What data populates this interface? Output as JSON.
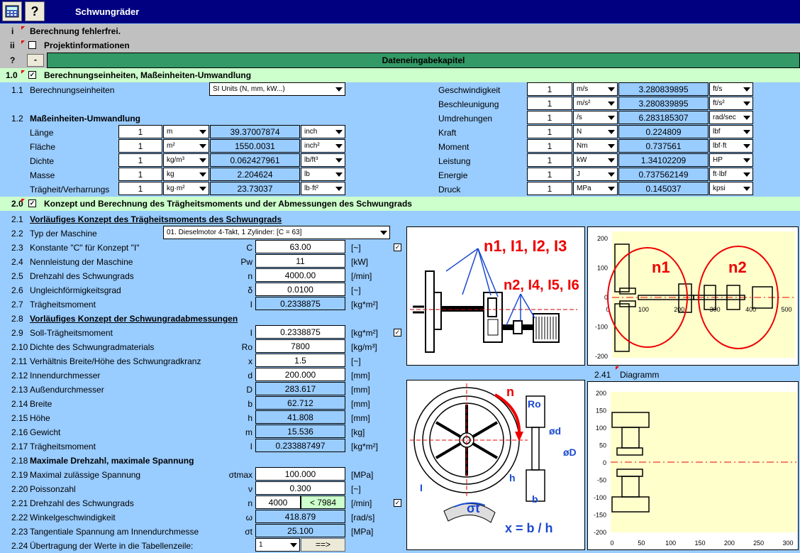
{
  "app": {
    "title": "Schwungräder",
    "help_label": "?"
  },
  "status": {
    "i_label": "i",
    "message": "Berechnung fehlerfrei.",
    "ii_label": "ii",
    "project_label": "Projektinformationen"
  },
  "chapter": {
    "q_label": "?",
    "minus_label": "-",
    "title": "Dateneingabekapitel"
  },
  "s10": {
    "num": "1.0",
    "title": "Berechnungseinheiten, Maßeinheiten-Umwandlung"
  },
  "r11": {
    "num": "1.1",
    "label": "Berechnungseinheiten",
    "select": "SI Units (N, mm, kW...)"
  },
  "r12": {
    "num": "1.2",
    "label": "Maßeinheiten-Umwandlung"
  },
  "conv_left": [
    {
      "name": "Länge",
      "val": "1",
      "unit": "m",
      "res": "39.37007874",
      "runit": "inch"
    },
    {
      "name": "Fläche",
      "val": "1",
      "unit": "m²",
      "res": "1550.0031",
      "runit": "inch²"
    },
    {
      "name": "Dichte",
      "val": "1",
      "unit": "kg/m³",
      "res": "0.062427961",
      "runit": "lb/ft³"
    },
    {
      "name": "Masse",
      "val": "1",
      "unit": "kg",
      "res": "2.204624",
      "runit": "lb"
    },
    {
      "name": "Trägheit/Verharrungs",
      "val": "1",
      "unit": "kg·m²",
      "res": "23.73037",
      "runit": "lb·ft²"
    }
  ],
  "conv_right": [
    {
      "name": "Geschwindigkeit",
      "val": "1",
      "unit": "m/s",
      "res": "3.280839895",
      "runit": "ft/s"
    },
    {
      "name": "Beschleunigung",
      "val": "1",
      "unit": "m/s²",
      "res": "3.280839895",
      "runit": "ft/s²"
    },
    {
      "name": "Umdrehungen",
      "val": "1",
      "unit": "/s",
      "res": "6.283185307",
      "runit": "rad/sec"
    },
    {
      "name": "Kraft",
      "val": "1",
      "unit": "N",
      "res": "0.224809",
      "runit": "lbf"
    },
    {
      "name": "Moment",
      "val": "1",
      "unit": "Nm",
      "res": "0.737561",
      "runit": "lbf·ft"
    },
    {
      "name": "Leistung",
      "val": "1",
      "unit": "kW",
      "res": "1.34102209",
      "runit": "HP"
    },
    {
      "name": "Energie",
      "val": "1",
      "unit": "J",
      "res": "0.737562149",
      "runit": "ft·lbf"
    },
    {
      "name": "Druck",
      "val": "1",
      "unit": "MPa",
      "res": "0.145037",
      "runit": "kpsi"
    }
  ],
  "s20": {
    "num": "2.0",
    "title": "Konzept und Berechnung des Trägheitsmoments und der Abmessungen des Schwungrads"
  },
  "r21": {
    "num": "2.1",
    "label": "Vorläufiges Konzept des Trägheitsmoments des Schwungrads"
  },
  "r22": {
    "num": "2.2",
    "label": "Typ der Maschine",
    "select": "01. Dieselmotor 4-Takt, 1 Zylinder:  [C = 63]"
  },
  "rows_a": [
    {
      "num": "2.3",
      "label": "Konstante \"C\" für Konzept \"I\"",
      "sym": "C",
      "val": "63.00",
      "unit": "[~]",
      "res": false
    },
    {
      "num": "2.4",
      "label": "Nennleistung der Maschine",
      "sym": "Pw",
      "val": "11",
      "unit": "[kW]",
      "res": false
    },
    {
      "num": "2.5",
      "label": "Drehzahl des Schwungrads",
      "sym": "n",
      "val": "4000.00",
      "unit": "[/min]",
      "res": false
    },
    {
      "num": "2.6",
      "label": "Ungleichförmigkeitsgrad",
      "sym": "δ",
      "val": "0.0100",
      "unit": "[~]",
      "res": false
    },
    {
      "num": "2.7",
      "label": "Trägheitsmoment",
      "sym": "I",
      "val": "0.2338875",
      "unit": "[kg*m²]",
      "res": true
    }
  ],
  "r28": {
    "num": "2.8",
    "label": "Vorläufiges Konzept der Schwungradabmessungen"
  },
  "rows_b": [
    {
      "num": "2.9",
      "label": "Soll-Trägheitsmoment",
      "sym": "I",
      "val": "0.2338875",
      "unit": "[kg*m²]",
      "res": false
    },
    {
      "num": "2.10",
      "label": "Dichte des Schwungradmaterials",
      "sym": "Ro",
      "val": "7800",
      "unit": "[kg/m³]",
      "res": false
    },
    {
      "num": "2.11",
      "label": "Verhältnis Breite/Höhe des Schwungradkranz",
      "sym": "x",
      "val": "1.5",
      "unit": "[~]",
      "res": false
    },
    {
      "num": "2.12",
      "label": "Innendurchmesser",
      "sym": "d",
      "val": "200.000",
      "unit": "[mm]",
      "res": false
    },
    {
      "num": "2.13",
      "label": "Außendurchmesser",
      "sym": "D",
      "val": "283.617",
      "unit": "[mm]",
      "res": true
    },
    {
      "num": "2.14",
      "label": "Breite",
      "sym": "b",
      "val": "62.712",
      "unit": "[mm]",
      "res": true
    },
    {
      "num": "2.15",
      "label": "Höhe",
      "sym": "h",
      "val": "41.808",
      "unit": "[mm]",
      "res": true
    },
    {
      "num": "2.16",
      "label": "Gewicht",
      "sym": "m",
      "val": "15.536",
      "unit": "[kg]",
      "res": true
    },
    {
      "num": "2.17",
      "label": "Trägheitsmoment",
      "sym": "I",
      "val": "0.233887497",
      "unit": "[kg*m²]",
      "res": true
    }
  ],
  "r218": {
    "num": "2.18",
    "label": "Maximale Drehzahl, maximale Spannung"
  },
  "rows_c": [
    {
      "num": "2.19",
      "label": "Maximal zulässige Spannung",
      "sym": "σtmax",
      "val": "100.000",
      "unit": "[MPa]",
      "res": false
    },
    {
      "num": "2.20",
      "label": "Poissonzahl",
      "sym": "ν",
      "val": "0.300",
      "unit": "[~]",
      "res": false
    },
    {
      "num": "2.21",
      "label": "Drehzahl des Schwungrads",
      "sym": "n",
      "val": "",
      "unit": "[/min]",
      "res": false
    },
    {
      "num": "2.22",
      "label": "Winkelgeschwindigkeit",
      "sym": "ω",
      "val": "418.879",
      "unit": "[rad/s]",
      "res": true
    },
    {
      "num": "2.23",
      "label": "Tangentiale Spannung am Innendurchmesse",
      "sym": "σt",
      "val": "25.100",
      "unit": "[MPa]",
      "res": true
    }
  ],
  "r221": {
    "val": "4000",
    "limit": "< 7984"
  },
  "r224": {
    "num": "2.24",
    "label": "Übertragung der Werte in die Tabellenzeile:",
    "select": "1",
    "button": "==>"
  },
  "r241": {
    "num": "2.41",
    "label": "Diagramm"
  },
  "pic1": {
    "label_a": "n1, I1, I2, I3",
    "label_b": "n2, I4, I5, I6"
  },
  "chart1": {
    "label_n1": "n1",
    "label_n2": "n2",
    "yticks": [
      "200",
      "100",
      "0",
      "-100",
      "-200"
    ],
    "xticks": [
      "0",
      "100",
      "200",
      "300",
      "400",
      "500"
    ]
  },
  "pic2": {
    "n": "n",
    "ro": "Ro",
    "od": "ød",
    "oD": "øD",
    "h": "h",
    "b": "b",
    "I": "I",
    "sigma": "σt",
    "formula": "x = b / h"
  },
  "chart2": {
    "yticks": [
      "200",
      "150",
      "100",
      "50",
      "0",
      "-50",
      "-100",
      "-150",
      "-200"
    ],
    "xticks": [
      "0",
      "50",
      "100",
      "150",
      "200",
      "250",
      "300"
    ]
  },
  "colors": {
    "title_bar": "#000080",
    "background": "#99ccff",
    "section": "#ccffcc",
    "chapter": "#339966",
    "chart_bg": "#ffffcc",
    "accent": "#ff0000"
  }
}
